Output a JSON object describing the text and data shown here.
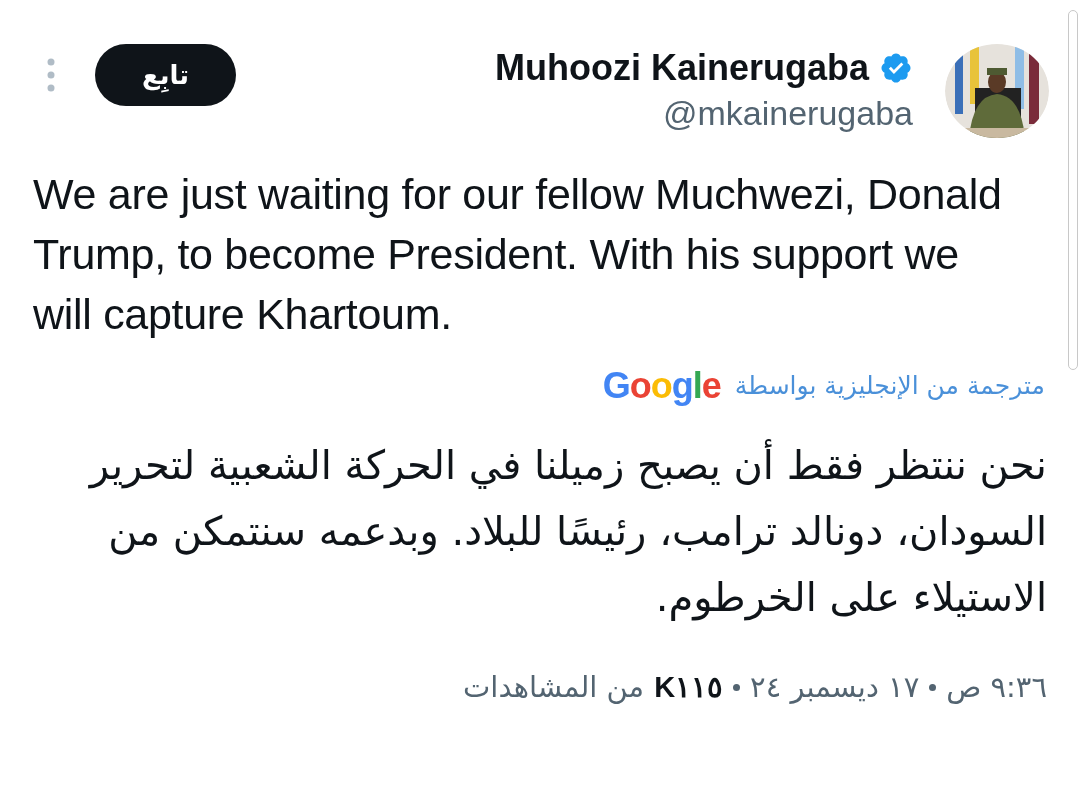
{
  "header": {
    "follow_button": "تابِع",
    "name": "Muhoozi Kainerugaba",
    "verified": true,
    "handle": "@mkainerugaba"
  },
  "tweet": {
    "text": "We are just waiting for our fellow Muchwezi, Donald Trump, to become President. With his support we will capture Khartoum."
  },
  "translation": {
    "label": "مترجمة من الإنجليزية بواسطة",
    "provider": "Google",
    "text": "نحن ننتظر فقط أن يصبح زميلنا في الحركة الشعبية لتحرير السودان، دونالد ترامب، رئيسًا للبلاد. وبدعمه سنتمكن من الاستيلاء على الخرطوم."
  },
  "footer": {
    "time": "٩:٣٦ ص",
    "date": "١٧ ديسمبر ٢٤",
    "views_count": "K١١٥",
    "views_label": "من المشاهدات"
  }
}
